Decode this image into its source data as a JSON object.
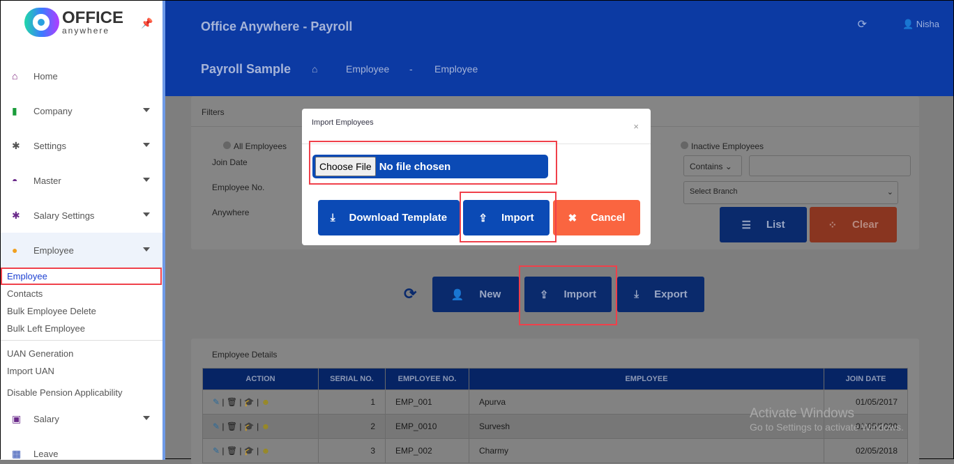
{
  "sidebar": {
    "logo_text": "OFFICE",
    "logo_sub": "anywhere",
    "items": [
      {
        "label": "Home",
        "icon": "home-icon"
      },
      {
        "label": "Company",
        "icon": "building-icon"
      },
      {
        "label": "Settings",
        "icon": "gear-icon"
      },
      {
        "label": "Master",
        "icon": "dashboard-icon"
      },
      {
        "label": "Salary Settings",
        "icon": "gear-icon"
      },
      {
        "label": "Employee",
        "icon": "user-icon"
      }
    ],
    "sub_items": [
      "Employee",
      "Contacts",
      "Bulk Employee Delete",
      "Bulk Left Employee"
    ],
    "extra_items": [
      "UAN Generation",
      "Import UAN",
      "Disable Pension Applicability"
    ],
    "bottom_items": [
      {
        "label": "Salary",
        "icon": "money-icon"
      },
      {
        "label": "Leave",
        "icon": "calendar-icon"
      }
    ]
  },
  "header": {
    "title": "Office Anywhere - Payroll",
    "user": "Nisha"
  },
  "breadcrumb": {
    "title": "Payroll Sample",
    "items": [
      "Employee",
      "-",
      "Employee"
    ]
  },
  "filters": {
    "title": "Filters",
    "all": "All Employees",
    "inactive": "Inactive Employees",
    "join_date": "Join Date",
    "employee_no": "Employee No.",
    "anywhere": "Anywhere",
    "contains": "Contains",
    "branch": "Select Branch",
    "list": "List",
    "clear": "Clear"
  },
  "actions": {
    "new": "New",
    "import": "Import",
    "export": "Export"
  },
  "details": {
    "title": "Employee Details",
    "columns": [
      "ACTION",
      "SERIAL NO.",
      "EMPLOYEE NO.",
      "EMPLOYEE",
      "JOIN DATE"
    ],
    "rows": [
      {
        "serial": "1",
        "no": "EMP_001",
        "name": "Apurva",
        "date": "01/05/2017"
      },
      {
        "serial": "2",
        "no": "EMP_0010",
        "name": "Survesh",
        "date": "01/05/2020"
      },
      {
        "serial": "3",
        "no": "EMP_002",
        "name": "Charmy",
        "date": "02/05/2018"
      }
    ]
  },
  "modal": {
    "title": "Import Employees",
    "close": "×",
    "choose": "Choose File",
    "no_file": "No file chosen",
    "download": "Download Template",
    "import": "Import",
    "cancel": "Cancel"
  },
  "watermark": {
    "line1": "Activate Windows",
    "line2": "Go to Settings to activate Windows."
  },
  "colors": {
    "primary": "#0b4ab5",
    "cancel": "#fa6540",
    "highlight": "#f0404a"
  }
}
